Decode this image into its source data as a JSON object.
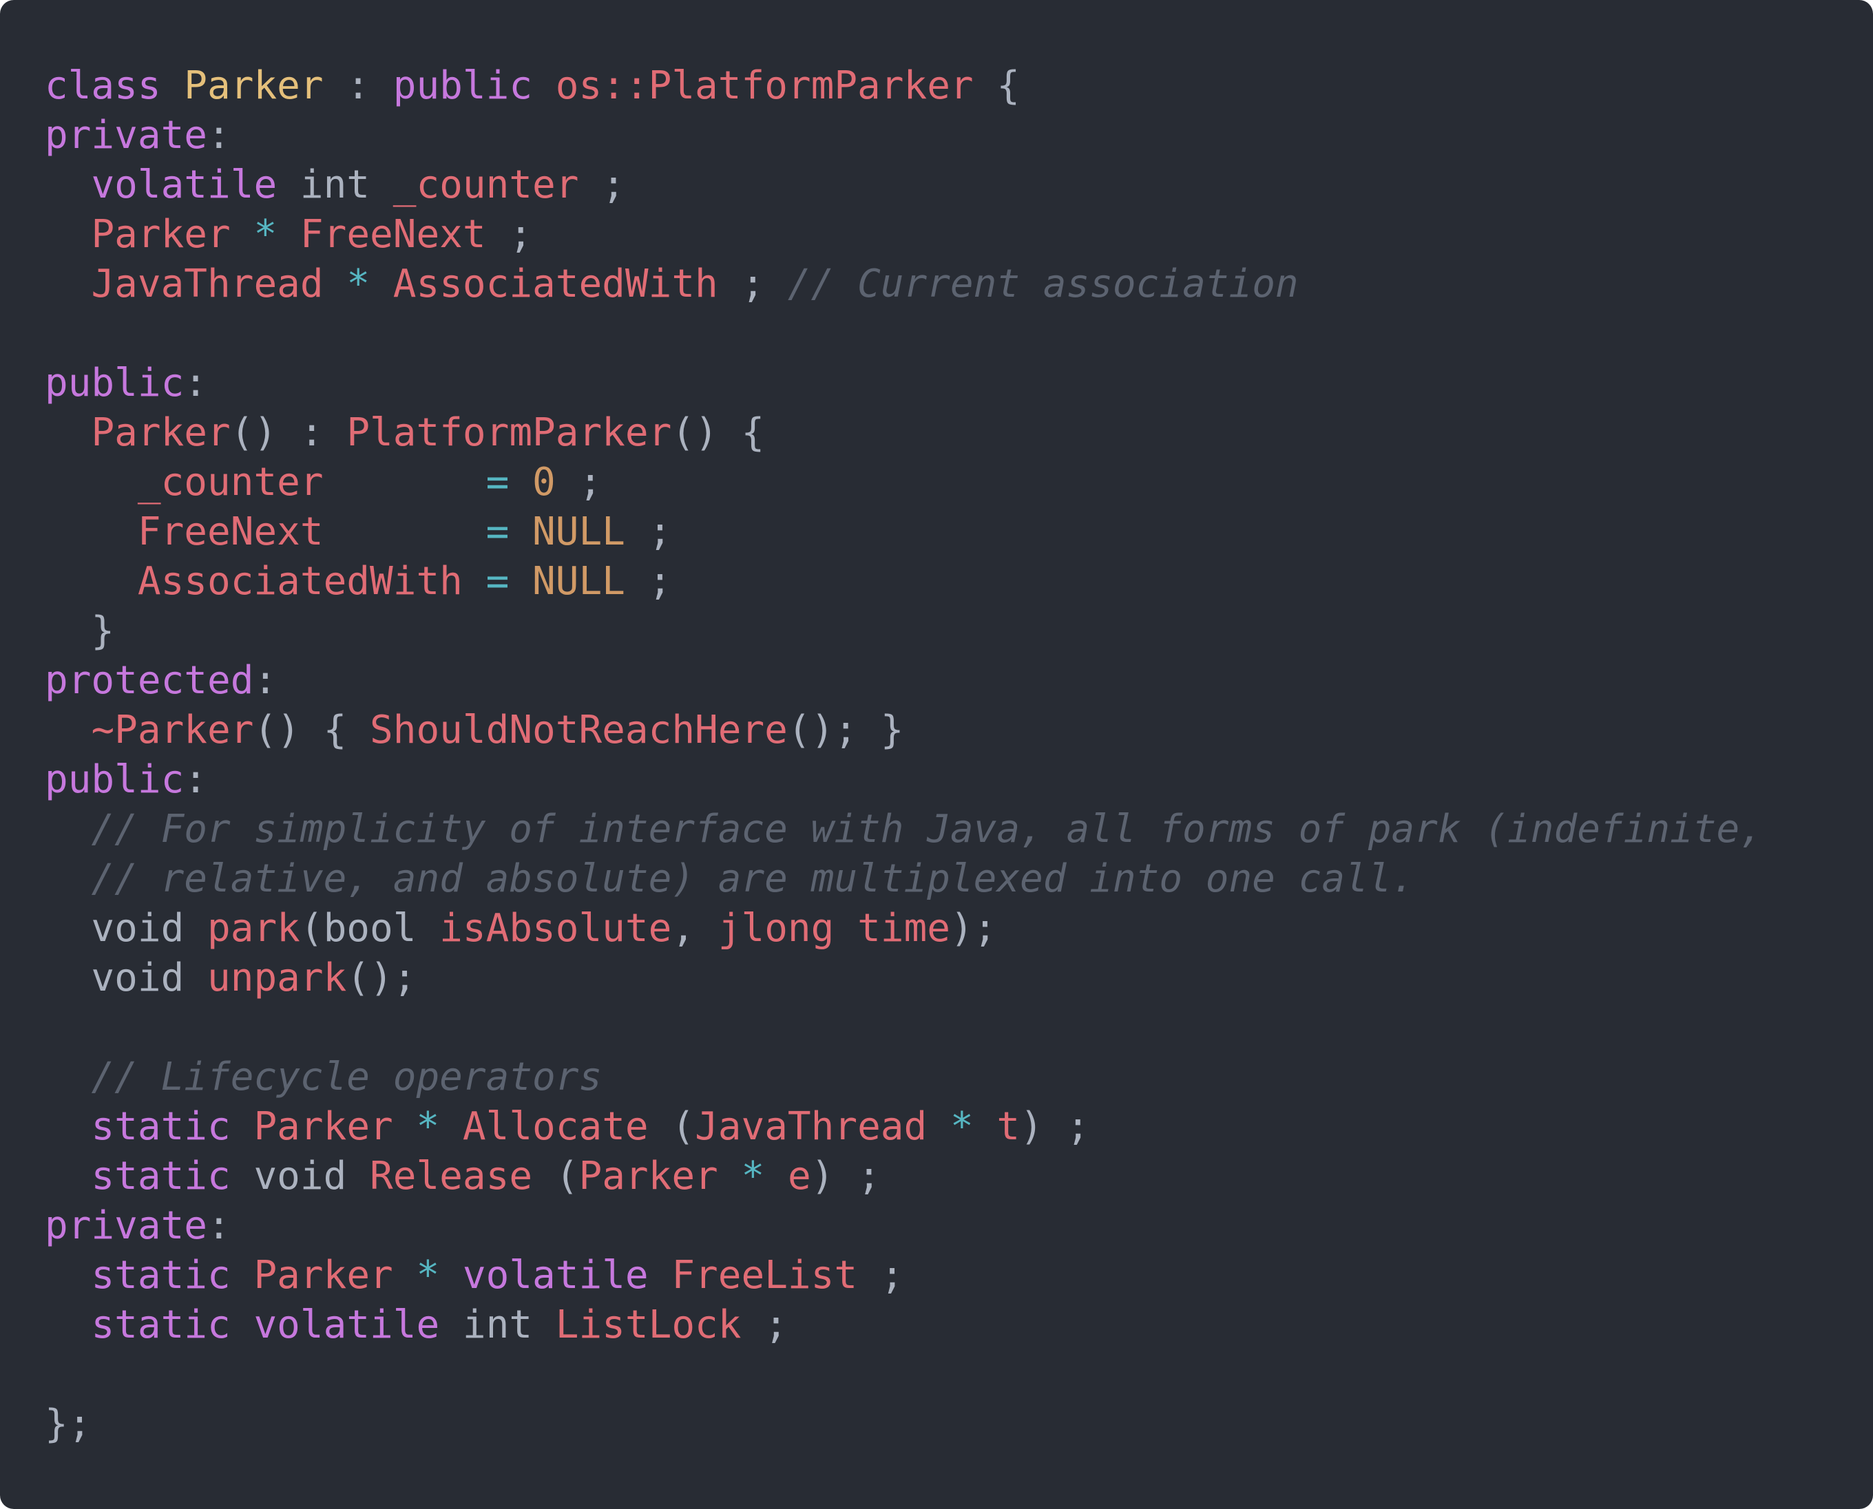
{
  "theme": {
    "background": "#282c34",
    "default": "#abb2bf",
    "keyword": "#c678dd",
    "type": "#e5c07b",
    "identifier": "#e06c75",
    "operator": "#56b6c2",
    "number": "#d19a66",
    "comment": "#5c6370"
  },
  "lines": [
    [
      [
        "class",
        "keyword"
      ],
      [
        " ",
        ""
      ],
      [
        "Parker",
        "type"
      ],
      [
        " : ",
        ""
      ],
      [
        "public",
        "keyword"
      ],
      [
        " ",
        ""
      ],
      [
        "os::PlatformParker",
        "identifier"
      ],
      [
        " {",
        ""
      ]
    ],
    [
      [
        "private",
        "keyword"
      ],
      [
        ":",
        ""
      ]
    ],
    [
      [
        "  ",
        ""
      ],
      [
        "volatile",
        "keyword"
      ],
      [
        " int ",
        ""
      ],
      [
        "_counter",
        "identifier"
      ],
      [
        " ;",
        ""
      ]
    ],
    [
      [
        "  ",
        ""
      ],
      [
        "Parker",
        "identifier"
      ],
      [
        " ",
        ""
      ],
      [
        "*",
        "operator"
      ],
      [
        " ",
        ""
      ],
      [
        "FreeNext",
        "identifier"
      ],
      [
        " ;",
        ""
      ]
    ],
    [
      [
        "  ",
        ""
      ],
      [
        "JavaThread",
        "identifier"
      ],
      [
        " ",
        ""
      ],
      [
        "*",
        "operator"
      ],
      [
        " ",
        ""
      ],
      [
        "AssociatedWith",
        "identifier"
      ],
      [
        " ; ",
        ""
      ],
      [
        "// Current association",
        "comment"
      ]
    ],
    [],
    [
      [
        "public",
        "keyword"
      ],
      [
        ":",
        ""
      ]
    ],
    [
      [
        "  ",
        ""
      ],
      [
        "Parker",
        "identifier"
      ],
      [
        "() : ",
        ""
      ],
      [
        "PlatformParker",
        "identifier"
      ],
      [
        "() {",
        ""
      ]
    ],
    [
      [
        "    ",
        ""
      ],
      [
        "_counter",
        "identifier"
      ],
      [
        "       ",
        ""
      ],
      [
        "=",
        "operator"
      ],
      [
        " ",
        ""
      ],
      [
        "0",
        "number"
      ],
      [
        " ;",
        ""
      ]
    ],
    [
      [
        "    ",
        ""
      ],
      [
        "FreeNext",
        "identifier"
      ],
      [
        "       ",
        ""
      ],
      [
        "=",
        "operator"
      ],
      [
        " ",
        ""
      ],
      [
        "NULL",
        "number"
      ],
      [
        " ;",
        ""
      ]
    ],
    [
      [
        "    ",
        ""
      ],
      [
        "AssociatedWith",
        "identifier"
      ],
      [
        " ",
        ""
      ],
      [
        "=",
        "operator"
      ],
      [
        " ",
        ""
      ],
      [
        "NULL",
        "number"
      ],
      [
        " ;",
        ""
      ]
    ],
    [
      [
        "  }",
        ""
      ]
    ],
    [
      [
        "protected",
        "keyword"
      ],
      [
        ":",
        ""
      ]
    ],
    [
      [
        "  ",
        ""
      ],
      [
        "~Parker",
        "identifier"
      ],
      [
        "() { ",
        ""
      ],
      [
        "ShouldNotReachHere",
        "identifier"
      ],
      [
        "(); }",
        ""
      ]
    ],
    [
      [
        "public",
        "keyword"
      ],
      [
        ":",
        ""
      ]
    ],
    [
      [
        "  ",
        ""
      ],
      [
        "// For simplicity of interface with Java, all forms of park (indefinite,",
        "comment"
      ]
    ],
    [
      [
        "  ",
        ""
      ],
      [
        "// relative, and absolute) are multiplexed into one call.",
        "comment"
      ]
    ],
    [
      [
        "  void ",
        ""
      ],
      [
        "park",
        "identifier"
      ],
      [
        "(bool ",
        ""
      ],
      [
        "isAbsolute",
        "identifier"
      ],
      [
        ", ",
        ""
      ],
      [
        "jlong",
        "identifier"
      ],
      [
        " ",
        ""
      ],
      [
        "time",
        "identifier"
      ],
      [
        ");",
        ""
      ]
    ],
    [
      [
        "  void ",
        ""
      ],
      [
        "unpark",
        "identifier"
      ],
      [
        "();",
        ""
      ]
    ],
    [],
    [
      [
        "  ",
        ""
      ],
      [
        "// Lifecycle operators",
        "comment"
      ]
    ],
    [
      [
        "  ",
        ""
      ],
      [
        "static",
        "keyword"
      ],
      [
        " ",
        ""
      ],
      [
        "Parker",
        "identifier"
      ],
      [
        " ",
        ""
      ],
      [
        "*",
        "operator"
      ],
      [
        " ",
        ""
      ],
      [
        "Allocate",
        "identifier"
      ],
      [
        " (",
        ""
      ],
      [
        "JavaThread",
        "identifier"
      ],
      [
        " ",
        ""
      ],
      [
        "*",
        "operator"
      ],
      [
        " ",
        ""
      ],
      [
        "t",
        "identifier"
      ],
      [
        ") ;",
        ""
      ]
    ],
    [
      [
        "  ",
        ""
      ],
      [
        "static",
        "keyword"
      ],
      [
        " void ",
        ""
      ],
      [
        "Release",
        "identifier"
      ],
      [
        " (",
        ""
      ],
      [
        "Parker",
        "identifier"
      ],
      [
        " ",
        ""
      ],
      [
        "*",
        "operator"
      ],
      [
        " ",
        ""
      ],
      [
        "e",
        "identifier"
      ],
      [
        ") ;",
        ""
      ]
    ],
    [
      [
        "private",
        "keyword"
      ],
      [
        ":",
        ""
      ]
    ],
    [
      [
        "  ",
        ""
      ],
      [
        "static",
        "keyword"
      ],
      [
        " ",
        ""
      ],
      [
        "Parker",
        "identifier"
      ],
      [
        " ",
        ""
      ],
      [
        "*",
        "operator"
      ],
      [
        " ",
        ""
      ],
      [
        "volatile",
        "keyword"
      ],
      [
        " ",
        ""
      ],
      [
        "FreeList",
        "identifier"
      ],
      [
        " ;",
        ""
      ]
    ],
    [
      [
        "  ",
        ""
      ],
      [
        "static",
        "keyword"
      ],
      [
        " ",
        ""
      ],
      [
        "volatile",
        "keyword"
      ],
      [
        " int ",
        ""
      ],
      [
        "ListLock",
        "identifier"
      ],
      [
        " ;",
        ""
      ]
    ],
    [],
    [
      [
        "};",
        ""
      ]
    ]
  ]
}
